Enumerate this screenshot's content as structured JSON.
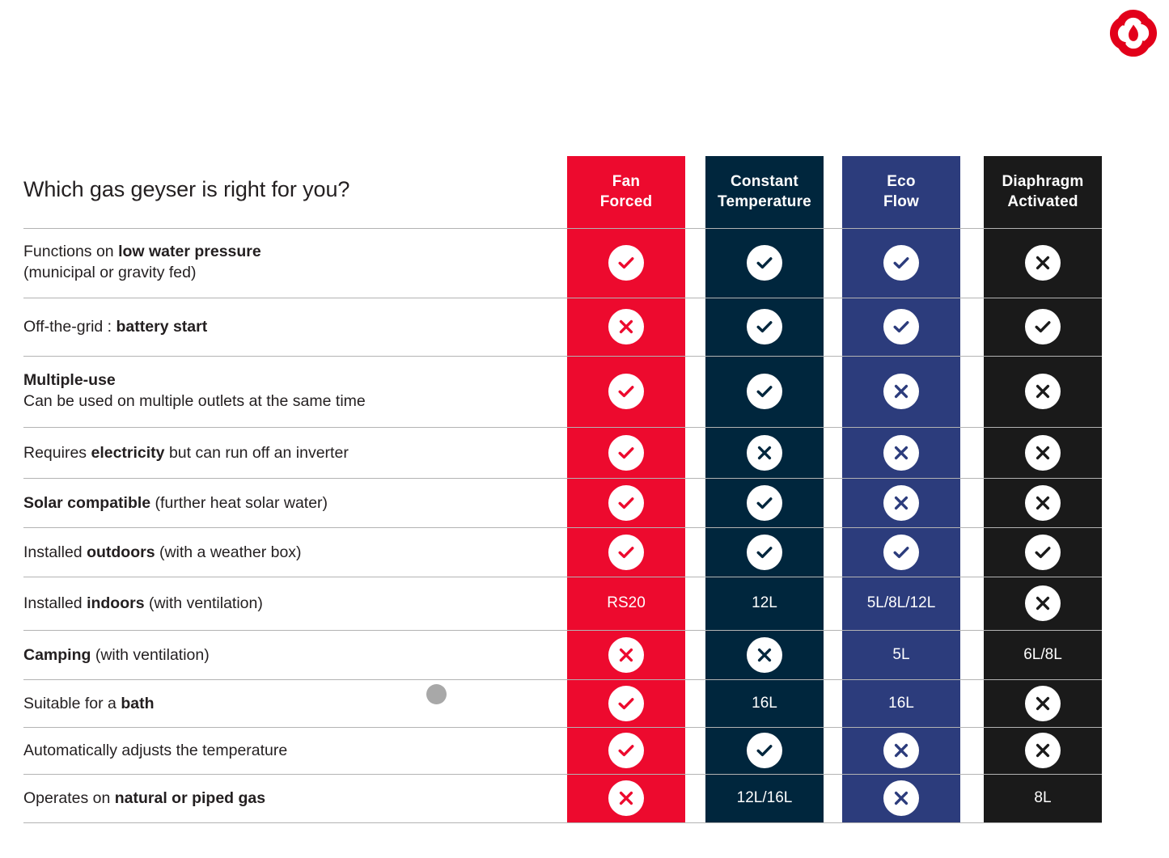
{
  "logo": {
    "icon": "flame-pinwheel-logo",
    "color": "#E2001A"
  },
  "title": "Which gas geyser is right for you?",
  "colors": {
    "fan": "#ED0A2E",
    "constant": "#00263D",
    "eco": "#2C3C7C",
    "diaphragm": "#1A1A1A",
    "separator": "#b3b3b3",
    "text": "#231f20",
    "cursor": "#a8a8a8"
  },
  "columns": [
    {
      "key": "fan",
      "line1": "Fan",
      "line2": "Forced",
      "color": "#ED0A2E"
    },
    {
      "key": "constant",
      "line1": "Constant",
      "line2": "Temperature",
      "color": "#00263D"
    },
    {
      "key": "eco",
      "line1": "Eco",
      "line2": "Flow",
      "color": "#2C3C7C"
    },
    {
      "key": "diaphragm",
      "line1": "Diaphragm",
      "line2": "Activated",
      "color": "#1A1A1A"
    }
  ],
  "rows": [
    {
      "label_line1_pre": "Functions on ",
      "label_line1_bold": "low water pressure",
      "label_line2": "(municipal or gravity fed)",
      "cells": [
        {
          "type": "check"
        },
        {
          "type": "check"
        },
        {
          "type": "check"
        },
        {
          "type": "cross"
        }
      ]
    },
    {
      "label_line1_pre": "Off-the-grid : ",
      "label_line1_bold": "battery start",
      "label_line2": "",
      "cells": [
        {
          "type": "cross"
        },
        {
          "type": "check"
        },
        {
          "type": "check"
        },
        {
          "type": "check"
        }
      ]
    },
    {
      "label_line1_pre": "",
      "label_line1_bold": "Multiple-use",
      "label_line2": "Can be used on multiple outlets at the same time",
      "cells": [
        {
          "type": "check"
        },
        {
          "type": "check"
        },
        {
          "type": "cross"
        },
        {
          "type": "cross"
        }
      ]
    },
    {
      "label_line1_pre": "Requires ",
      "label_line1_bold": "electricity",
      "label_line1_post": " but can run off an inverter",
      "label_line2": "",
      "cells": [
        {
          "type": "check"
        },
        {
          "type": "cross"
        },
        {
          "type": "cross"
        },
        {
          "type": "cross"
        }
      ]
    },
    {
      "label_line1_pre": "",
      "label_line1_bold": "Solar compatible",
      "label_line1_post": " (further heat solar water)",
      "label_line2": "",
      "cells": [
        {
          "type": "check"
        },
        {
          "type": "check"
        },
        {
          "type": "cross"
        },
        {
          "type": "cross"
        }
      ]
    },
    {
      "label_line1_pre": "Installed ",
      "label_line1_bold": "outdoors",
      "label_line1_post": " (with a weather box)",
      "label_line2": "",
      "cells": [
        {
          "type": "check"
        },
        {
          "type": "check"
        },
        {
          "type": "check"
        },
        {
          "type": "check"
        }
      ]
    },
    {
      "label_line1_pre": "Installed ",
      "label_line1_bold": "indoors",
      "label_line1_post": " (with ventilation)",
      "label_line2": "",
      "cells": [
        {
          "type": "text",
          "text": "RS20"
        },
        {
          "type": "text",
          "text": "12L"
        },
        {
          "type": "text",
          "text": "5L/8L/12L"
        },
        {
          "type": "cross"
        }
      ]
    },
    {
      "label_line1_pre": "",
      "label_line1_bold": "Camping",
      "label_line1_post": " (with ventilation)",
      "label_line2": "",
      "cells": [
        {
          "type": "cross"
        },
        {
          "type": "cross"
        },
        {
          "type": "text",
          "text": "5L"
        },
        {
          "type": "text",
          "text": "6L/8L"
        }
      ]
    },
    {
      "label_line1_pre": "Suitable for a ",
      "label_line1_bold": "bath",
      "label_line2": "",
      "cells": [
        {
          "type": "check"
        },
        {
          "type": "text",
          "text": "16L"
        },
        {
          "type": "text",
          "text": "16L"
        },
        {
          "type": "cross"
        }
      ]
    },
    {
      "label_line1_pre": "Automatically adjusts the temperature",
      "label_line1_bold": "",
      "label_line2": "",
      "cells": [
        {
          "type": "check"
        },
        {
          "type": "check"
        },
        {
          "type": "cross"
        },
        {
          "type": "cross"
        }
      ]
    },
    {
      "label_line1_pre": "Operates on ",
      "label_line1_bold": "natural or piped gas",
      "label_line2": "",
      "cells": [
        {
          "type": "cross"
        },
        {
          "type": "text",
          "text": "12L/16L"
        },
        {
          "type": "cross"
        },
        {
          "type": "text",
          "text": "8L"
        }
      ]
    }
  ],
  "cursor": {
    "icon": "cursor-dot"
  }
}
